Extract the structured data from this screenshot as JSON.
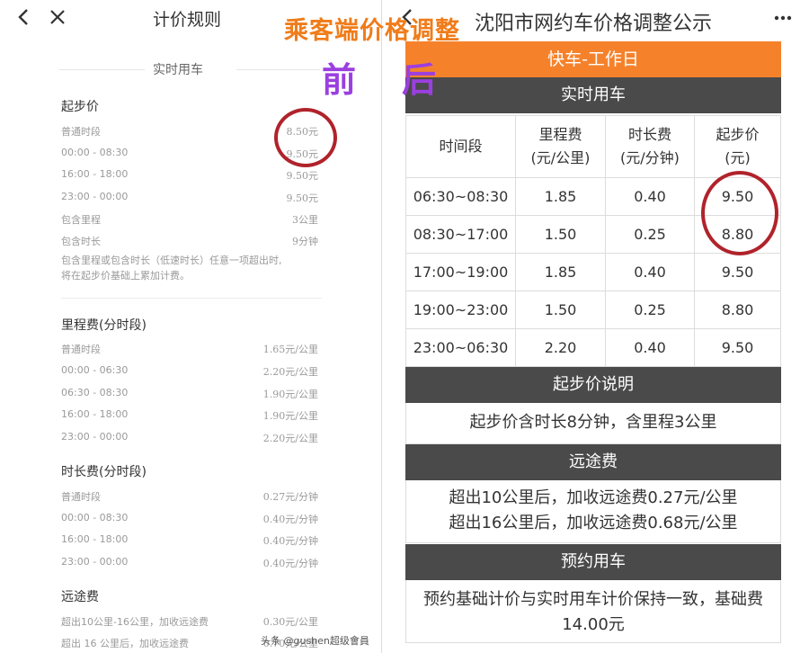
{
  "left": {
    "title": "计价规则",
    "section": "实时用车",
    "base_price": {
      "heading": "起步价",
      "rows": [
        {
          "label": "普通时段",
          "value": "8.50元"
        },
        {
          "label": "00:00 - 08:30",
          "value": "9.50元"
        },
        {
          "label": "16:00 - 18:00",
          "value": "9.50元"
        },
        {
          "label": "23:00 - 00:00",
          "value": "9.50元"
        },
        {
          "label": "包含里程",
          "value": "3公里"
        },
        {
          "label": "包含时长",
          "value": "9分钟"
        }
      ],
      "note_line1": "包含里程或包含时长（低速时长）任意一项超出时,",
      "note_line2": "将在起步价基础上累加计费。"
    },
    "mileage": {
      "heading": "里程费(分时段)",
      "rows": [
        {
          "label": "普通时段",
          "value": "1.65元/公里"
        },
        {
          "label": "00:00 - 06:30",
          "value": "2.20元/公里"
        },
        {
          "label": "06:30 - 08:30",
          "value": "1.90元/公里"
        },
        {
          "label": "16:00 - 18:00",
          "value": "1.90元/公里"
        },
        {
          "label": "23:00 - 00:00",
          "value": "2.20元/公里"
        }
      ]
    },
    "duration": {
      "heading": "时长费(分时段)",
      "rows": [
        {
          "label": "普通时段",
          "value": "0.27元/分钟"
        },
        {
          "label": "00:00 - 08:30",
          "value": "0.40元/分钟"
        },
        {
          "label": "16:00 - 18:00",
          "value": "0.40元/分钟"
        },
        {
          "label": "23:00 - 00:00",
          "value": "0.40元/分钟"
        }
      ]
    },
    "long_distance": {
      "heading": "远途费",
      "rows": [
        {
          "label": "超出10公里-16公里，加收远途费",
          "value": "0.30元/公里"
        },
        {
          "label": "超出 16 公里后，加收远途费",
          "value": "0.70元/公里"
        }
      ]
    },
    "watermark": "头条 @gushen超级會員"
  },
  "overlay": {
    "title": "乘客端价格调整",
    "before": "前",
    "after": "后",
    "annotation_color": "#b0232b"
  },
  "right": {
    "title": "沈阳市网约车价格调整公示",
    "category": "快车-工作日",
    "section_realtime": "实时用车",
    "table": {
      "headers": [
        "时间段",
        "里程费\n(元/公里)",
        "时长费\n(元/分钟)",
        "起步价\n(元)"
      ],
      "rows": [
        [
          "06:30~08:30",
          "1.85",
          "0.40",
          "9.50"
        ],
        [
          "08:30~17:00",
          "1.50",
          "0.25",
          "8.80"
        ],
        [
          "17:00~19:00",
          "1.85",
          "0.40",
          "9.50"
        ],
        [
          "19:00~23:00",
          "1.50",
          "0.25",
          "8.80"
        ],
        [
          "23:00~06:30",
          "2.20",
          "0.40",
          "9.50"
        ]
      ]
    },
    "base_note_title": "起步价说明",
    "base_note": "起步价含时长8分钟，含里程3公里",
    "long_title": "远途费",
    "long_line1": "超出10公里后，加收远途费0.27元/公里",
    "long_line2": "超出16公里后，加收远途费0.68元/公里",
    "booking_title": "预约用车",
    "booking_line1": "预约基础计价与实时用车计价保持一致，基础费",
    "booking_line2": "14.00元",
    "colors": {
      "orange": "#f5822b",
      "dark": "#4a4a4a"
    }
  }
}
